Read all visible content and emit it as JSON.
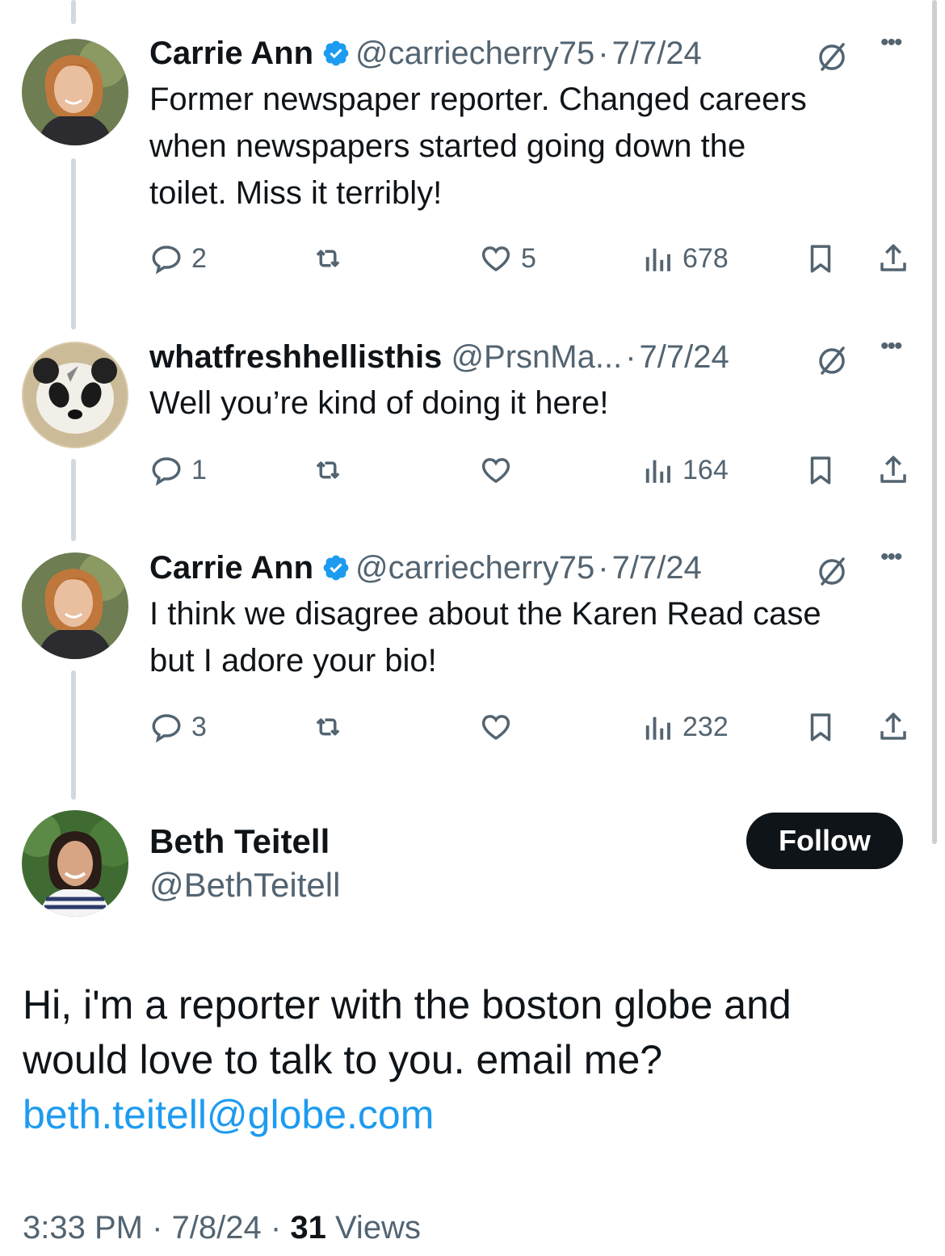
{
  "thread": [
    {
      "name": "Carrie Ann",
      "handle": "@carriecherry75",
      "separator": "·",
      "date": "7/7/24",
      "text_lines": [
        "Former newspaper reporter. Changed careers",
        "when newspapers started going down the",
        "toilet. Miss it terribly!"
      ],
      "replies": "2",
      "retweets": "",
      "likes": "5",
      "views": "678",
      "verified": true
    },
    {
      "name": "whatfreshhellisthis",
      "handle": "@PrsnMa...",
      "separator": "·",
      "date": "7/7/24",
      "text_lines": [
        "Well you’re kind of doing it here!"
      ],
      "replies": "1",
      "retweets": "",
      "likes": "",
      "views": "164",
      "verified": false
    },
    {
      "name": "Carrie Ann",
      "handle": "@carriecherry75",
      "separator": "·",
      "date": "7/7/24",
      "text_lines": [
        "I think we disagree about the Karen Read case",
        "but I adore your bio!"
      ],
      "replies": "3",
      "retweets": "",
      "likes": "",
      "views": "232",
      "verified": true
    }
  ],
  "main_tweet": {
    "name": "Beth Teitell",
    "handle": "@BethTeitell",
    "follow_label": "Follow",
    "text_line1": "Hi, i'm a reporter with the boston globe and",
    "text_line2": "would love to talk to you. email me?",
    "email": "beth.teitell@globe.com",
    "time": "3:33 PM",
    "separator": "·",
    "date": "7/8/24",
    "views_count": "31",
    "views_label": "Views"
  },
  "icons": {
    "reply": "reply-icon",
    "retweet": "retweet-icon",
    "like": "like-icon",
    "views": "views-icon",
    "bookmark": "bookmark-icon",
    "share": "share-icon",
    "grok": "grok-icon",
    "more": "more-icon",
    "verified": "verified-badge-icon"
  },
  "colors": {
    "text": "#0f1419",
    "muted": "#536471",
    "link": "#1d9bf0",
    "verified": "#1d9bf0",
    "follow_bg": "#0f1419"
  }
}
